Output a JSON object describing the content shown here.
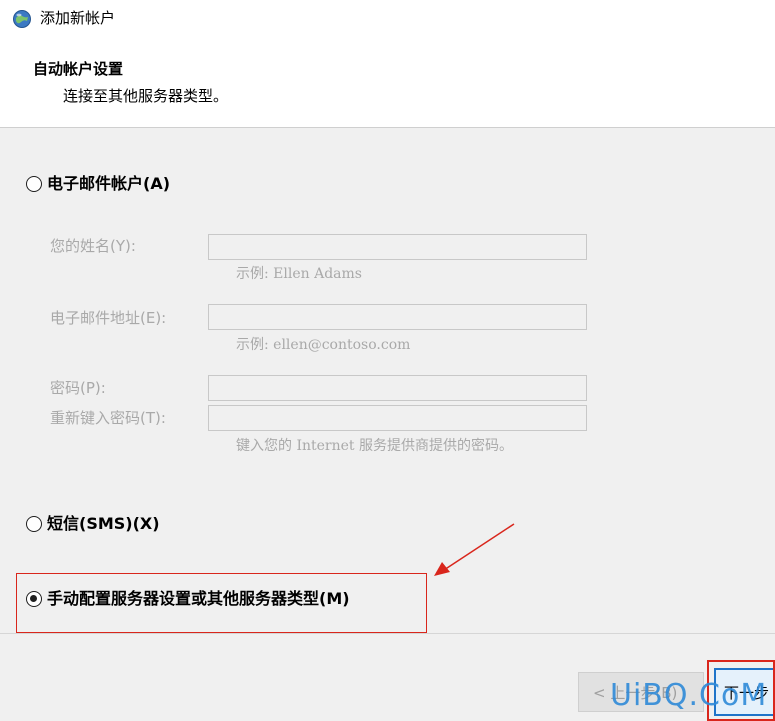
{
  "window": {
    "title": "添加新帐户",
    "icon": "outlook-account-icon"
  },
  "header": {
    "title": "自动帐户设置",
    "subtitle": "连接至其他服务器类型。"
  },
  "options": {
    "email_account": {
      "label": "电子邮件帐户(A)",
      "selected": false
    },
    "sms": {
      "label": "短信(SMS)(X)",
      "selected": false
    },
    "manual": {
      "label": "手动配置服务器设置或其他服务器类型(M)",
      "selected": true
    }
  },
  "form": {
    "name": {
      "label": "您的姓名(Y):",
      "value": "",
      "hint": "示例: Ellen Adams"
    },
    "email": {
      "label": "电子邮件地址(E):",
      "value": "",
      "hint": "示例: ellen@contoso.com"
    },
    "password": {
      "label": "密码(P):",
      "value": ""
    },
    "retype_password": {
      "label": "重新键入密码(T):",
      "value": ""
    },
    "password_hint": "键入您的 Internet 服务提供商提供的密码。"
  },
  "footer": {
    "back_label": "< 上一步(B)",
    "next_label": "下一步"
  },
  "watermark": "UiBQ.CoM",
  "colors": {
    "annotation": "#d9261c",
    "accent": "#1f74c9"
  }
}
